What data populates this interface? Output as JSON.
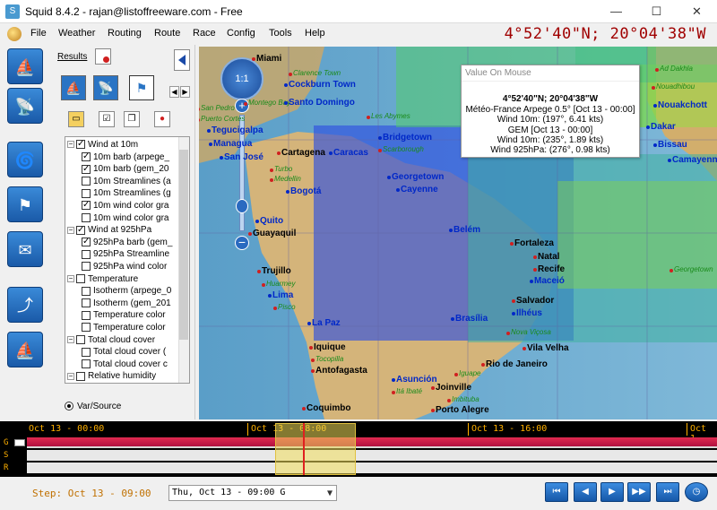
{
  "window": {
    "title": "Squid 8.4.2 - rajan@listoffreeware.com - Free",
    "controls": [
      "—",
      "☐",
      "✕"
    ]
  },
  "menu": {
    "items": [
      "File",
      "Weather",
      "Routing",
      "Route",
      "Race",
      "Config",
      "Tools",
      "Help"
    ]
  },
  "coordinates": "4°52'40\"N; 20°04'38\"W",
  "panel": {
    "results_label": "Results",
    "tree": [
      {
        "label": "Wind at 10m",
        "level": 0,
        "checked": true,
        "expanded": true
      },
      {
        "label": "10m barb (arpege_",
        "level": 1,
        "checked": true
      },
      {
        "label": "10m barb (gem_20",
        "level": 1,
        "checked": true
      },
      {
        "label": "10m Streamlines (a",
        "level": 1,
        "checked": false
      },
      {
        "label": "10m Streamlines (g",
        "level": 1,
        "checked": false
      },
      {
        "label": "10m wind color gra",
        "level": 1,
        "checked": true
      },
      {
        "label": "10m wind color gra",
        "level": 1,
        "checked": false
      },
      {
        "label": "Wind at 925hPa",
        "level": 0,
        "checked": true,
        "expanded": true
      },
      {
        "label": "925hPa barb (gem_",
        "level": 1,
        "checked": true
      },
      {
        "label": "925hPa Streamline",
        "level": 1,
        "checked": false
      },
      {
        "label": "925hPa wind color",
        "level": 1,
        "checked": false
      },
      {
        "label": "Temperature",
        "level": 0,
        "checked": false,
        "expanded": true
      },
      {
        "label": "Isotherm (arpege_0",
        "level": 1,
        "checked": false
      },
      {
        "label": "Isotherm (gem_201",
        "level": 1,
        "checked": false
      },
      {
        "label": "Temperature color",
        "level": 1,
        "checked": false
      },
      {
        "label": "Temperature color",
        "level": 1,
        "checked": false
      },
      {
        "label": "Total cloud cover",
        "level": 0,
        "checked": false,
        "expanded": true
      },
      {
        "label": "Total cloud cover (",
        "level": 1,
        "checked": false
      },
      {
        "label": "Total cloud cover c",
        "level": 1,
        "checked": false
      },
      {
        "label": "Relative humidity",
        "level": 0,
        "checked": false,
        "expanded": true
      }
    ],
    "var_source_label": "Var/Source"
  },
  "map": {
    "zoom_label": "1:1",
    "cities": [
      {
        "name": "Miami",
        "style": "black"
      },
      {
        "name": "Cockburn Town",
        "style": "blue"
      },
      {
        "name": "Clarence Town",
        "style": "green"
      },
      {
        "name": "Montego Bay",
        "style": "green"
      },
      {
        "name": "Santo Domingo",
        "style": "blue"
      },
      {
        "name": "Puerto Cortes",
        "style": "green"
      },
      {
        "name": "Les Abymes",
        "style": "green"
      },
      {
        "name": "Tegucigalpa",
        "style": "blue"
      },
      {
        "name": "Managua",
        "style": "blue"
      },
      {
        "name": "San José",
        "style": "blue"
      },
      {
        "name": "San Pedro",
        "style": "green"
      },
      {
        "name": "Bridgetown",
        "style": "blue"
      },
      {
        "name": "Cartagena",
        "style": "black"
      },
      {
        "name": "Caracas",
        "style": "blue"
      },
      {
        "name": "Scarborough",
        "style": "green"
      },
      {
        "name": "Turbo",
        "style": "green"
      },
      {
        "name": "Medellin",
        "style": "green"
      },
      {
        "name": "Georgetown",
        "style": "blue"
      },
      {
        "name": "Cayenne",
        "style": "blue"
      },
      {
        "name": "Bogotá",
        "style": "blue"
      },
      {
        "name": "Quito",
        "style": "blue"
      },
      {
        "name": "Guayaquil",
        "style": "black"
      },
      {
        "name": "Belém",
        "style": "blue"
      },
      {
        "name": "Fortaleza",
        "style": "black"
      },
      {
        "name": "Natal",
        "style": "black"
      },
      {
        "name": "Recife",
        "style": "black"
      },
      {
        "name": "Maceió",
        "style": "blue"
      },
      {
        "name": "Trujillo",
        "style": "black"
      },
      {
        "name": "Huarmey",
        "style": "green"
      },
      {
        "name": "Lima",
        "style": "blue"
      },
      {
        "name": "Pisco",
        "style": "green"
      },
      {
        "name": "Salvador",
        "style": "black"
      },
      {
        "name": "Ilhéus",
        "style": "blue"
      },
      {
        "name": "La Paz",
        "style": "blue"
      },
      {
        "name": "Brasília",
        "style": "blue"
      },
      {
        "name": "Nova Viçosa",
        "style": "green"
      },
      {
        "name": "Iquique",
        "style": "black"
      },
      {
        "name": "Vila Velha",
        "style": "black"
      },
      {
        "name": "Tocopilla",
        "style": "green"
      },
      {
        "name": "Antofagasta",
        "style": "black"
      },
      {
        "name": "Rio de Janeiro",
        "style": "black"
      },
      {
        "name": "Asunción",
        "style": "blue"
      },
      {
        "name": "Iguape",
        "style": "green"
      },
      {
        "name": "Itá Ibaté",
        "style": "green"
      },
      {
        "name": "Joinville",
        "style": "black"
      },
      {
        "name": "Imbituba",
        "style": "green"
      },
      {
        "name": "Coquimbo",
        "style": "black"
      },
      {
        "name": "Porto Alegre",
        "style": "black"
      },
      {
        "name": "Ad Dakhla",
        "style": "green"
      },
      {
        "name": "Nouadhibou",
        "style": "green"
      },
      {
        "name": "Nouakchott",
        "style": "blue"
      },
      {
        "name": "Dakar",
        "style": "blue"
      },
      {
        "name": "Bissau",
        "style": "blue"
      },
      {
        "name": "Camayenne",
        "style": "blue"
      },
      {
        "name": "Georgetown",
        "style": "green"
      }
    ]
  },
  "value_on_mouse": {
    "title": "Value On Mouse",
    "position": "4°52'40\"N; 20°04'38\"W",
    "source1": "Météo-France Arpege 0.5°  [Oct 13 - 00:00]",
    "wind1": "Wind 10m: (197°, 6.41 kts)",
    "source2": "GEM  [Oct 13 - 00:00]",
    "wind2": "Wind 10m: (235°, 1.89 kts)",
    "wind3": "Wind 925hPa: (276°, 0.98 kts)"
  },
  "timeline": {
    "labels": [
      "Oct 13 - 00:00",
      "Oct 13 - 08:00",
      "Oct 13 - 16:00",
      "Oct 1"
    ],
    "rows": [
      "G",
      "S",
      "R"
    ]
  },
  "bottom": {
    "step_label": "Step: Oct 13 - 09:00",
    "date_value": "Thu, Oct 13 - 09:00 G",
    "playback": [
      "⏮",
      "◀",
      "▶",
      "▶▶",
      "⏭"
    ]
  },
  "colors": {
    "coordinates": "#a00000",
    "timeline_text": "#ffb000",
    "cursor": "#e02020",
    "accent": "#1a5aa8"
  }
}
